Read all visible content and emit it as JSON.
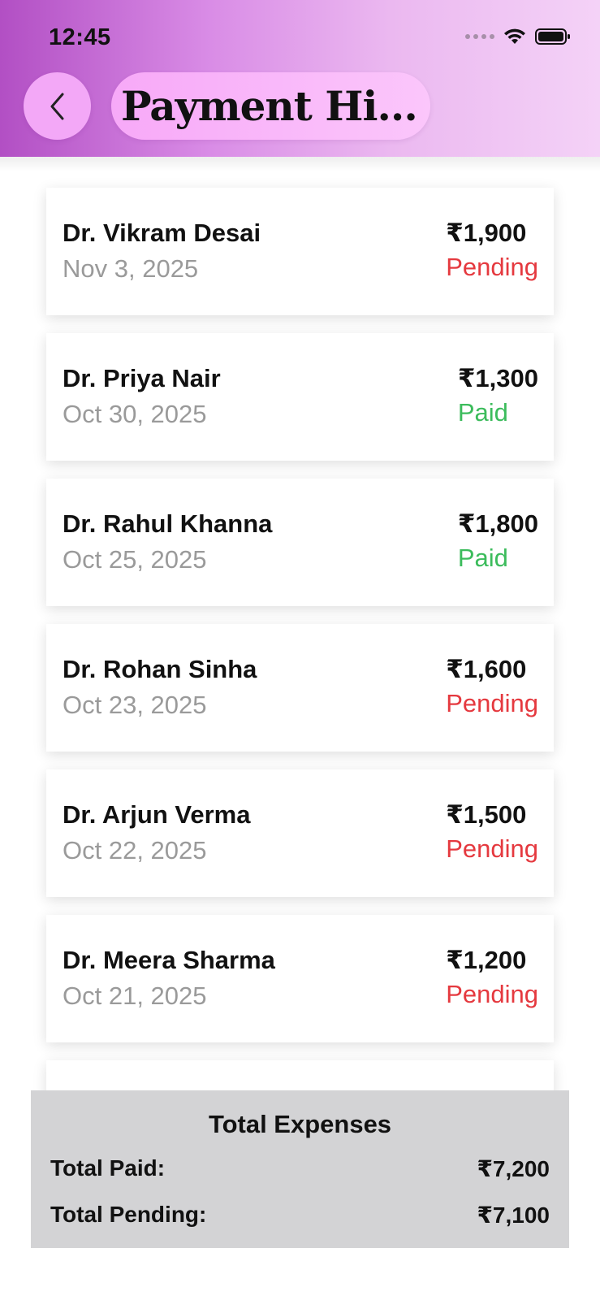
{
  "status_bar": {
    "time": "12:45"
  },
  "header": {
    "title": "Payment Hi...",
    "back_icon": "chevron-left-icon",
    "background_colors": [
      "#b24fc4",
      "#f4d2f7"
    ]
  },
  "payments": [
    {
      "doctor": "Dr. Vikram Desai",
      "date": "Nov 3, 2025",
      "amount": "₹1,900",
      "status": "Pending"
    },
    {
      "doctor": "Dr. Priya Nair",
      "date": "Oct 30, 2025",
      "amount": "₹1,300",
      "status": "Paid"
    },
    {
      "doctor": "Dr. Rahul Khanna",
      "date": "Oct 25, 2025",
      "amount": "₹1,800",
      "status": "Paid"
    },
    {
      "doctor": "Dr. Rohan Sinha",
      "date": "Oct 23, 2025",
      "amount": "₹1,600",
      "status": "Pending"
    },
    {
      "doctor": "Dr. Arjun Verma",
      "date": "Oct 22, 2025",
      "amount": "₹1,500",
      "status": "Pending"
    },
    {
      "doctor": "Dr. Meera Sharma",
      "date": "Oct 21, 2025",
      "amount": "₹1,200",
      "status": "Pending"
    }
  ],
  "colors": {
    "pending": "#e5393f",
    "paid": "#3cbc5c",
    "summary_bg": "#d3d3d5"
  },
  "summary": {
    "title": "Total Expenses",
    "paid_label": "Total Paid:",
    "paid_value": "₹7,200",
    "pending_label": "Total Pending:",
    "pending_value": "₹7,100"
  }
}
